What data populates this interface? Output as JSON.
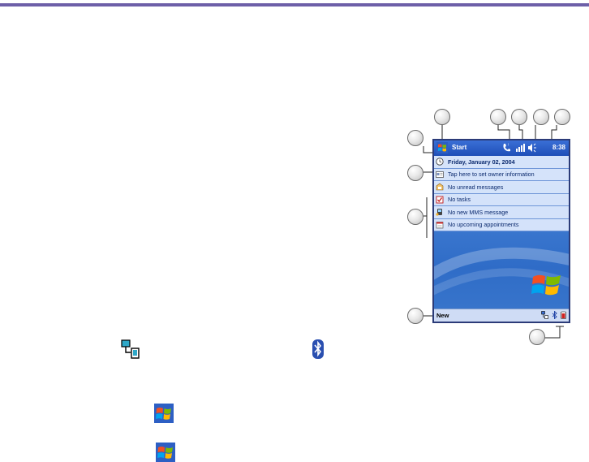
{
  "screen": {
    "start_label": "Start",
    "clock": "8:38",
    "today_items": [
      {
        "icon": "clock-icon",
        "label": "Friday, January 02, 2004"
      },
      {
        "icon": "owner-card-icon",
        "label": "Tap here to set owner information"
      },
      {
        "icon": "inbox-icon",
        "label": "No unread messages"
      },
      {
        "icon": "tasks-icon",
        "label": "No tasks"
      },
      {
        "icon": "mms-icon",
        "label": "No new MMS message"
      },
      {
        "icon": "calendar-icon",
        "label": "No upcoming appointments"
      }
    ],
    "new_label": "New"
  },
  "colors": {
    "accent_line": "#6d5fa8",
    "titlebar": "#1f4fb8",
    "today_background": "#3f7bd1"
  }
}
